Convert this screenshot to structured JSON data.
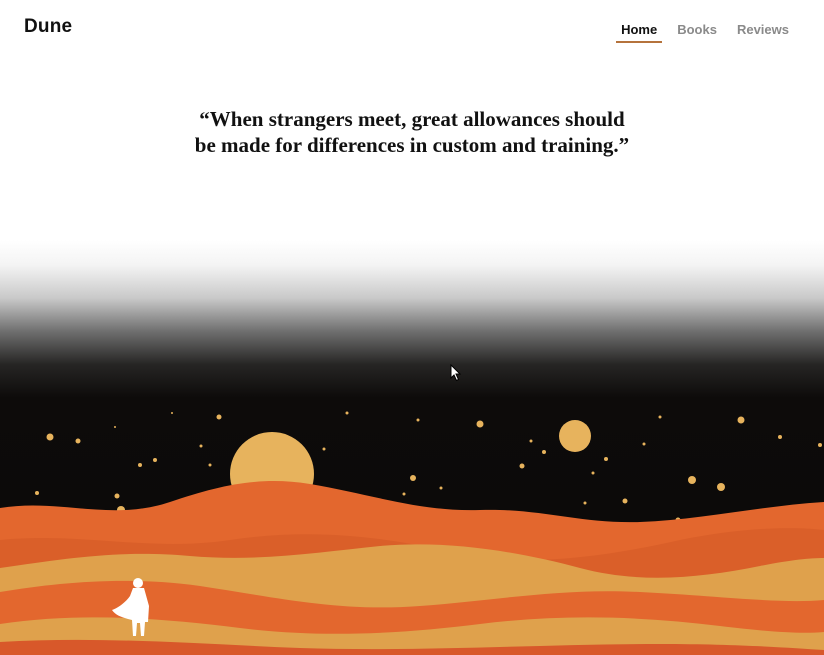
{
  "header": {
    "brand": "Dune",
    "nav": [
      {
        "label": "Home",
        "active": true
      },
      {
        "label": "Books",
        "active": false
      },
      {
        "label": "Reviews",
        "active": false
      }
    ]
  },
  "quote": {
    "line1": "“When strangers meet, great allowances should",
    "line2": "be made for differences in custom and training.”"
  },
  "hero": {
    "illustration_icon": "desert-dunes-night-illustration",
    "figure_icon": "cloaked-figure-icon",
    "colors": {
      "sky": "#0b0908",
      "dune_orange": "#e3672e",
      "dune_sand": "#dfa14c",
      "moon": "#e7b35d"
    }
  },
  "cursor_icon": "mouse-pointer-icon"
}
